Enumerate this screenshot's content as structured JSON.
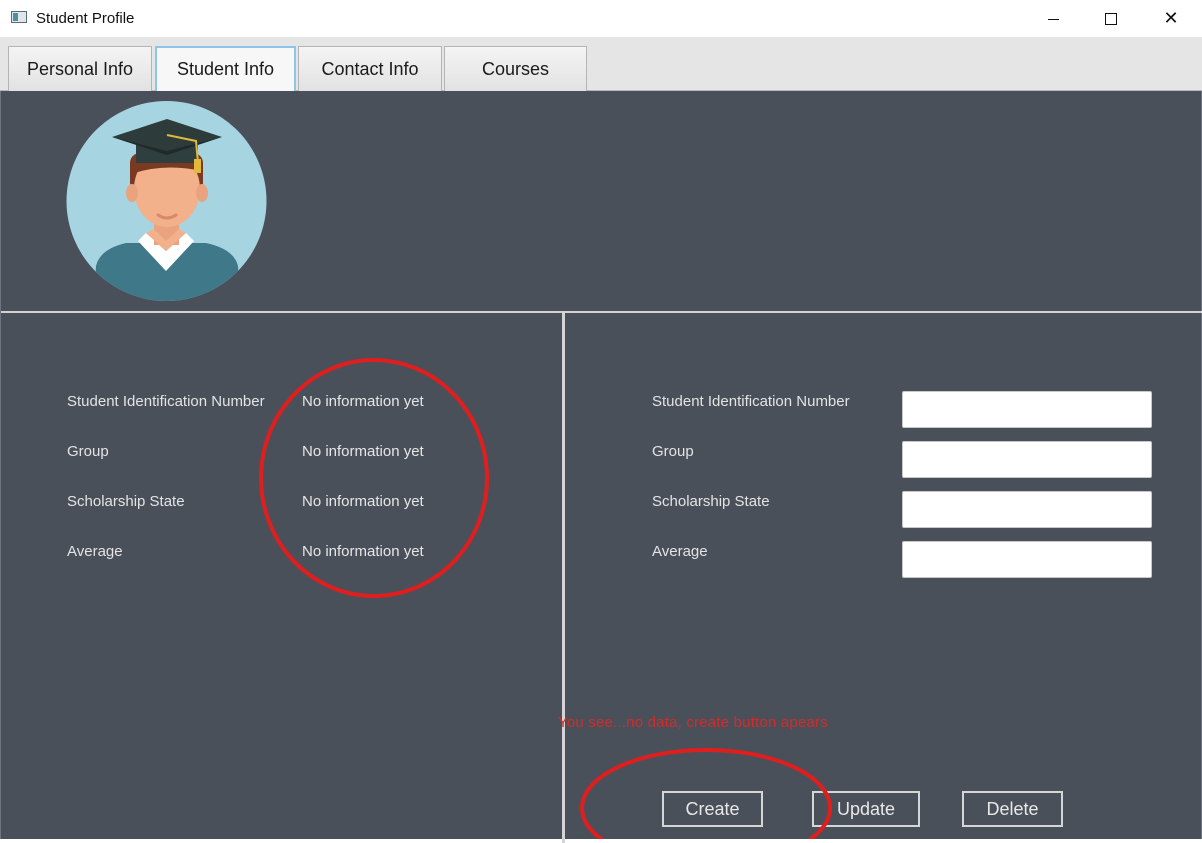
{
  "window": {
    "title": "Student Profile",
    "minimize_icon": "minimize-icon",
    "maximize_icon": "maximize-icon",
    "close_icon": "close-icon",
    "close_glyph": "✕"
  },
  "tabs": [
    {
      "label": "Personal Info",
      "active": false
    },
    {
      "label": "Student Info",
      "active": true
    },
    {
      "label": "Contact Info",
      "active": false
    },
    {
      "label": "Courses",
      "active": false
    }
  ],
  "info_panel": {
    "rows": [
      {
        "label": "Student Identification Number",
        "value": "No information yet"
      },
      {
        "label": "Group",
        "value": "No information yet"
      },
      {
        "label": "Scholarship State",
        "value": "No information yet"
      },
      {
        "label": "Average",
        "value": "No information yet"
      }
    ]
  },
  "form_panel": {
    "fields": [
      {
        "label": "Student Identification Number",
        "value": ""
      },
      {
        "label": "Group",
        "value": ""
      },
      {
        "label": "Scholarship State",
        "value": ""
      },
      {
        "label": "Average",
        "value": ""
      }
    ],
    "buttons": {
      "create": "Create",
      "update": "Update",
      "delete": "Delete"
    }
  },
  "annotation": {
    "note": "You see...no data, create button apears",
    "color": "#d42a2a"
  },
  "colors": {
    "background": "#4a505a",
    "divider": "#d4d4d4",
    "active_tab_border": "#8ec4e8"
  }
}
